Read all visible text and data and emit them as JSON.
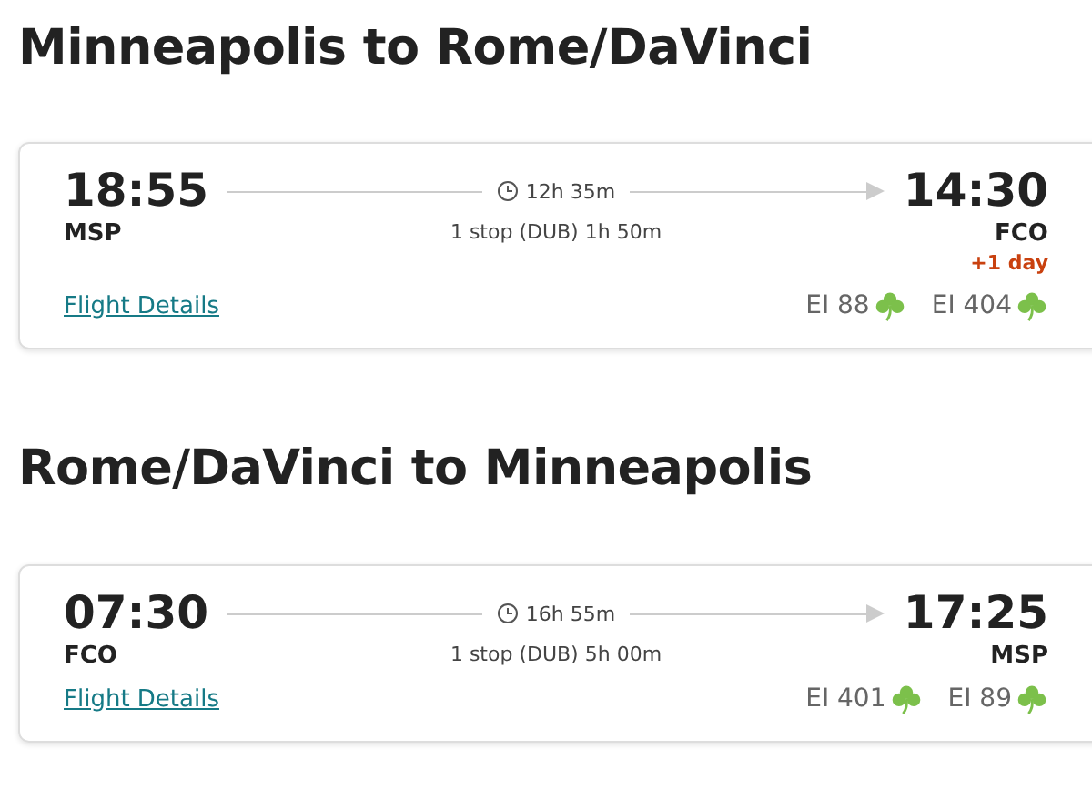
{
  "sections": [
    {
      "heading": "Minneapolis to Rome/DaVinci",
      "flight": {
        "depart_time": "18:55",
        "depart_airport": "MSP",
        "duration": "12h 35m",
        "stops": "1 stop (DUB) 1h 50m",
        "arrive_time": "14:30",
        "arrive_airport": "FCO",
        "day_offset": "+1 day",
        "details_link": "Flight Details",
        "segments": [
          "EI 88",
          "EI 404"
        ]
      }
    },
    {
      "heading": "Rome/DaVinci to Minneapolis",
      "flight": {
        "depart_time": "07:30",
        "depart_airport": "FCO",
        "duration": "16h 55m",
        "stops": "1 stop (DUB) 5h 00m",
        "arrive_time": "17:25",
        "arrive_airport": "MSP",
        "details_link": "Flight Details",
        "segments": [
          "EI 401",
          "EI 89"
        ]
      }
    }
  ]
}
